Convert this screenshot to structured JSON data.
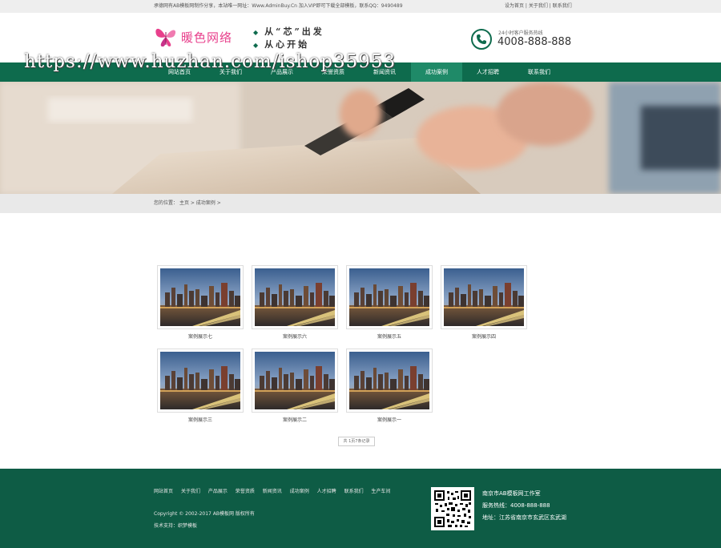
{
  "topbar": {
    "notice": "承德网有AB模板网制作分享，本站唯一网址：Www.AdminBuy.Cn 加入VIP即可下载全部模板，联系QQ：9490489",
    "links": [
      "设为首页",
      "关于我们",
      "联系我们"
    ]
  },
  "header": {
    "logo_text": "暖色网络",
    "slogan": [
      "从“芯”出发",
      "从心开始"
    ],
    "hotline_caption": "24小时客户服务热线",
    "hotline_number": "4008-888-888"
  },
  "nav": {
    "items": [
      "网站首页",
      "关于我们",
      "产品展示",
      "荣誉资质",
      "新闻资讯",
      "成功案例",
      "人才招聘",
      "联系我们"
    ],
    "active_index": 5
  },
  "watermark": "https://www.huzhan.com/ishop35953",
  "breadcrumb": {
    "label": "您的位置：",
    "home": "主页",
    "current": "成功案例"
  },
  "cases": [
    {
      "title": "案例展示七"
    },
    {
      "title": "案例展示六"
    },
    {
      "title": "案例展示五"
    },
    {
      "title": "案例展示四"
    },
    {
      "title": "案例展示三"
    },
    {
      "title": "案例展示二"
    },
    {
      "title": "案例展示一"
    }
  ],
  "pager": {
    "text": "共 1页7条记录"
  },
  "footer": {
    "nav": [
      "网站首页",
      "关于我们",
      "产品展示",
      "荣誉资质",
      "新闻资讯",
      "成功案例",
      "人才招聘",
      "联系我们",
      "生产车间"
    ],
    "copyright": "Copyright © 2002-2017 AB模板网 版权所有",
    "tech_support": "技术支持：织梦模板",
    "company": "南京市AB模板网工作室",
    "service_hotline": "服务热线：4008-888-888",
    "address": "地址：江苏省南京市玄武区玄武湖"
  },
  "colors": {
    "brand_green": "#0e6b4d",
    "footer_green": "#0e5c45",
    "logo_pink": "#e8408c"
  }
}
